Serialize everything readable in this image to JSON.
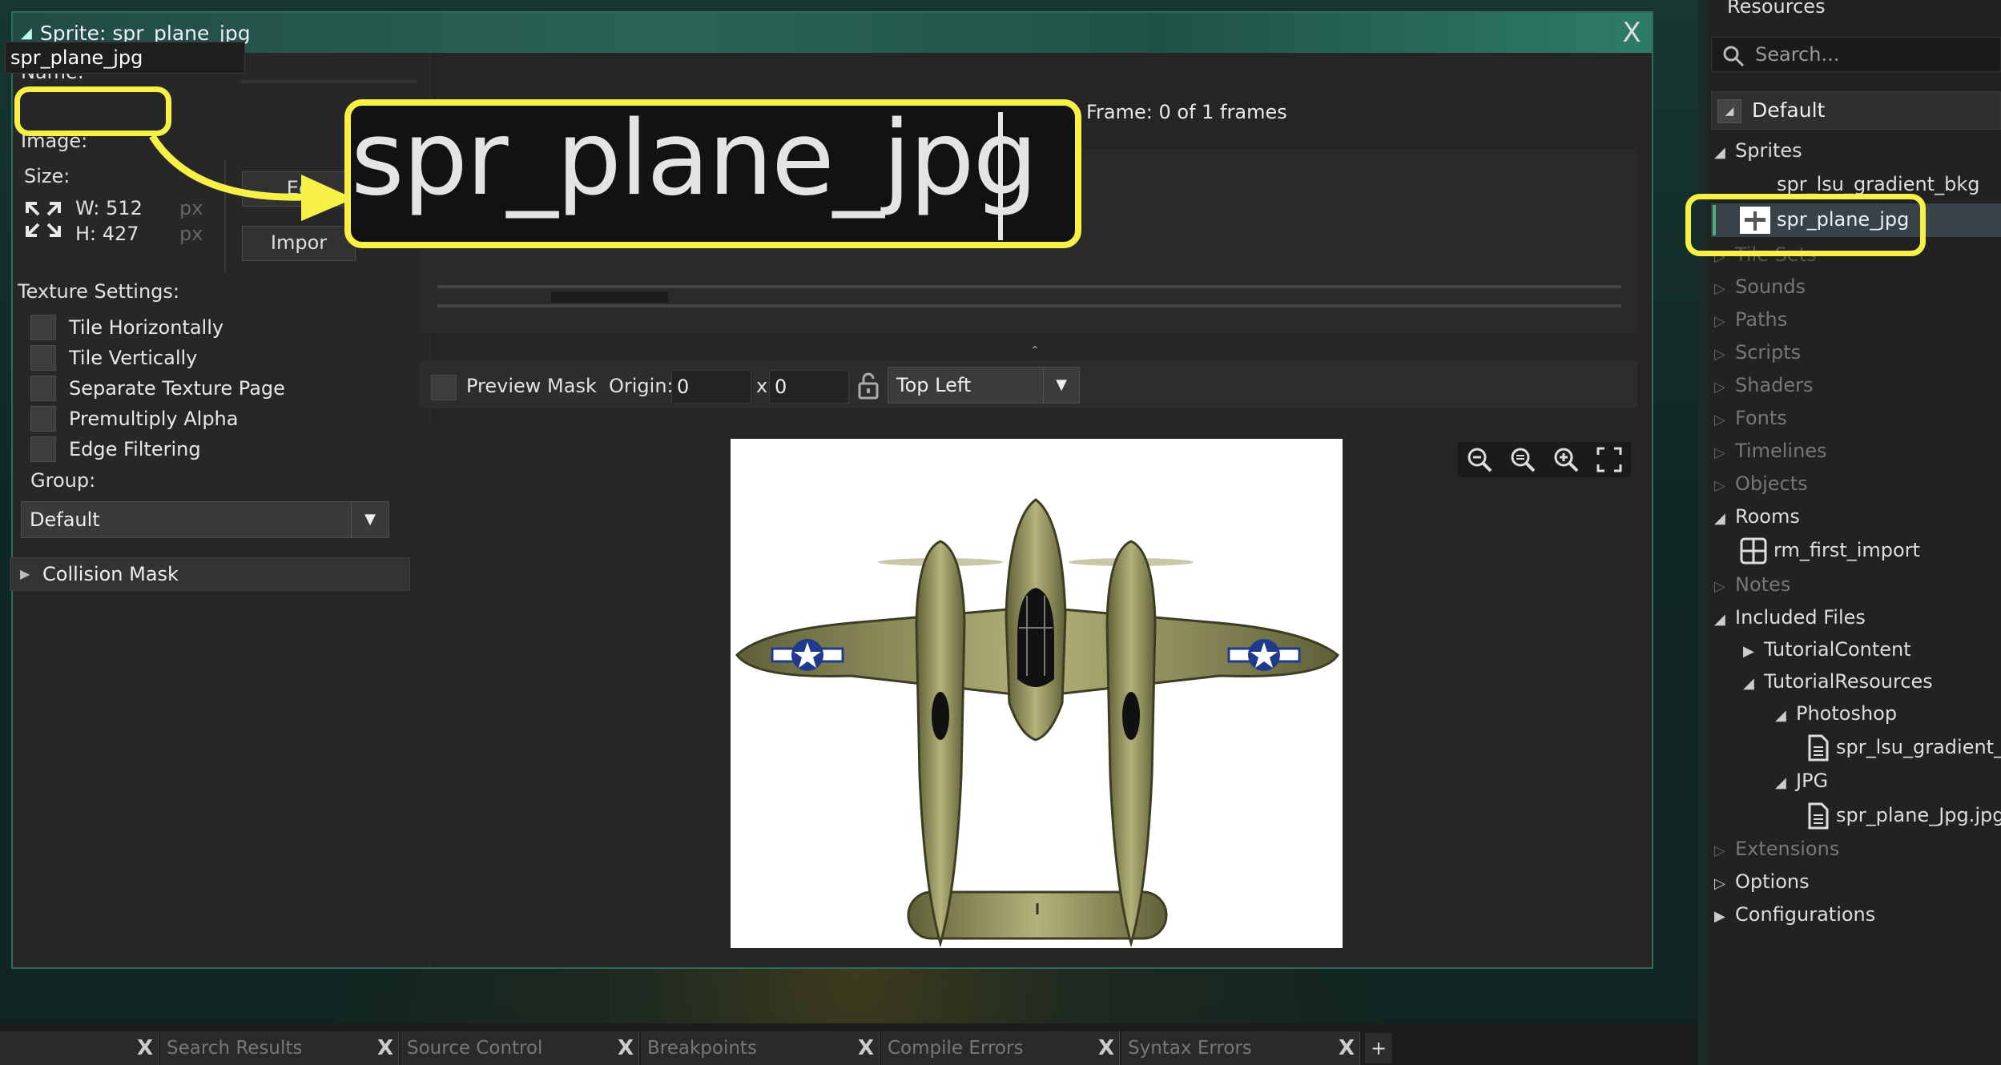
{
  "window": {
    "title": "Sprite: spr_plane_jpg",
    "close": "X"
  },
  "left": {
    "name_label": "Name:",
    "name_value": "spr_plane_jpg",
    "image_label": "Image:",
    "size_label": "Size:",
    "width": "W: 512",
    "height": "H: 427",
    "unit_w": "px",
    "unit_h": "px",
    "edit_button": "Ed",
    "import_button": "Impor",
    "texture_settings_label": "Texture Settings:",
    "checks": [
      "Tile Horizontally",
      "Tile Vertically",
      "Separate Texture Page",
      "Premultiply Alpha",
      "Edge Filtering"
    ],
    "group_label": "Group:",
    "group_value": "Default",
    "collision_mask": "Collision Mask"
  },
  "callout": {
    "zoom_text": "spr_plane_jpg"
  },
  "editor": {
    "frame_label": "Frame: 0 of 1 frames",
    "preview_mask": "Preview Mask",
    "origin_label": "Origin:",
    "origin_x": "0",
    "origin_x_sep": "x",
    "origin_y": "0",
    "origin_preset": "Top Left"
  },
  "resources": {
    "title": "Resources",
    "search_placeholder": "Search...",
    "default_label": "Default",
    "sprites": "Sprites",
    "sprite_bkg": "spr_lsu_gradient_bkg",
    "sprite_plane": "spr_plane_jpg",
    "tile_sets": "Tile Sets",
    "sounds": "Sounds",
    "paths": "Paths",
    "scripts": "Scripts",
    "shaders": "Shaders",
    "fonts": "Fonts",
    "timelines": "Timelines",
    "objects": "Objects",
    "rooms": "Rooms",
    "room_first": "rm_first_import",
    "notes": "Notes",
    "included_files": "Included Files",
    "tutorial_content": "TutorialContent",
    "tutorial_resources": "TutorialResources",
    "photoshop": "Photoshop",
    "psd_file": "spr_lsu_gradient_b",
    "jpg": "JPG",
    "jpg_file": "spr_plane_Jpg.jpg",
    "extensions": "Extensions",
    "options": "Options",
    "configurations": "Configurations"
  },
  "bottom_tabs": [
    "",
    "Search Results",
    "Source Control",
    "Breakpoints",
    "Compile Errors",
    "Syntax Errors"
  ],
  "tab_close": "X",
  "tab_add": "+",
  "colors": {
    "highlight": "#f6f047",
    "plane_olive": "#8a8a55",
    "roundel_blue": "#1f3a8c"
  }
}
